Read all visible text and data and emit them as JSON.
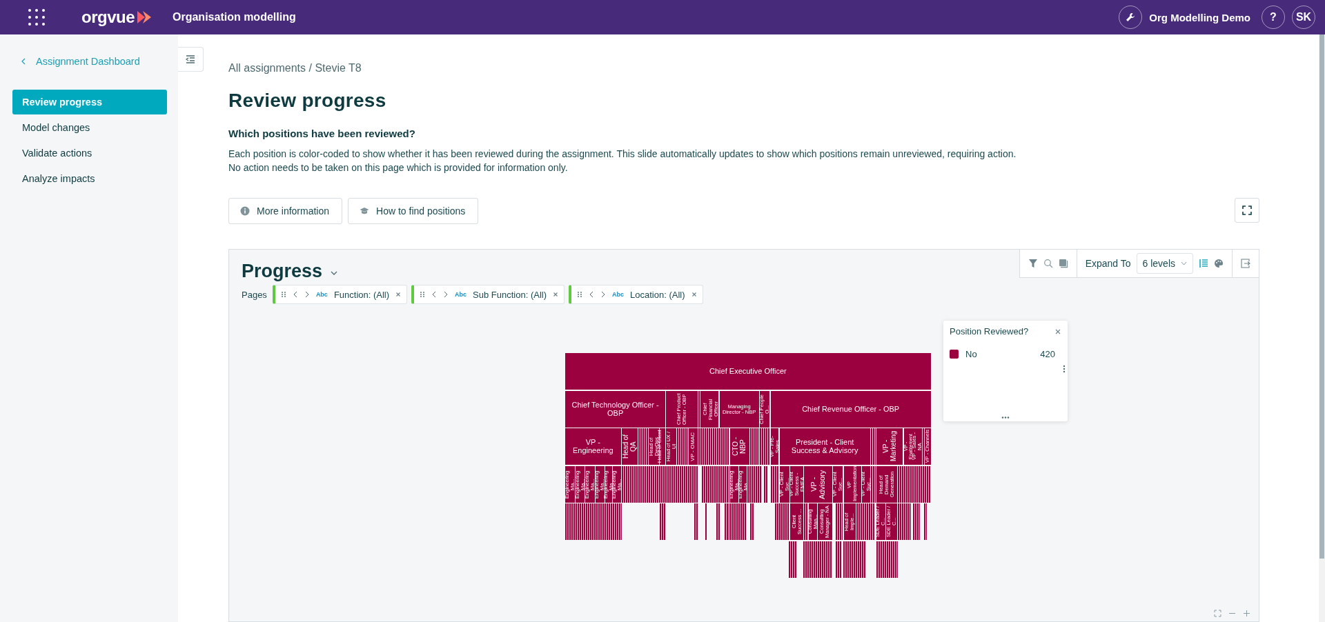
{
  "header": {
    "logo": "orgvue",
    "title": "Organisation modelling",
    "workspace": "Org Modelling Demo",
    "help": "?",
    "avatar": "SK"
  },
  "sidebar": {
    "back_link": "Assignment Dashboard",
    "items": [
      {
        "label": "Review progress",
        "selected": true
      },
      {
        "label": "Model changes",
        "selected": false
      },
      {
        "label": "Validate actions",
        "selected": false
      },
      {
        "label": "Analyze impacts",
        "selected": false
      }
    ]
  },
  "breadcrumb": "All assignments / Stevie T8",
  "title": "Review progress",
  "question": "Which positions have been reviewed?",
  "description": [
    "Each position is color-coded to show whether it has been reviewed during the assignment. This slide automatically updates to show which positions remain unreviewed, requiring action.",
    "No action needs to be taken on this page which is provided for information only."
  ],
  "buttons": [
    {
      "label": "More information",
      "kind": "info"
    },
    {
      "label": "How to find positions",
      "kind": "guide"
    }
  ],
  "panel": {
    "title": "Progress",
    "expand_label": "Expand To",
    "expand_value": "6 levels",
    "pages_label": "Pages",
    "filters": [
      {
        "type": "Abc",
        "label": "Function: (All)"
      },
      {
        "type": "Abc",
        "label": "Sub Function: (All)"
      },
      {
        "type": "Abc",
        "label": "Location: (All)"
      }
    ],
    "legend": {
      "title": "Position Reviewed?",
      "items": [
        {
          "label": "No",
          "count": "420",
          "color": "#9b003f"
        }
      ]
    },
    "org_chart": {
      "nodes": [
        "Chief Executive Officer",
        "Chief Technology Officer - OBP",
        "Chief Product Officer - OBP",
        "Chief Financial Officer",
        "Managing Director - NBP",
        "Chief People O...",
        "Chief Revenue Officer - OBP",
        "VP - Engineering",
        "Head of QA",
        "Head of DevOps",
        "Head of Client ...",
        "Head of UX / UI",
        "VP - OMAC",
        "CTO - NBP",
        "VP - Pre-Sales",
        "President - Client Success & Advisory",
        "VP - Marketing",
        "VP - Enablement",
        "VP - Sales - NA",
        "VP - Channels",
        "Engineering Ma...",
        "Engineering Ma...",
        "Engineering Ma...",
        "Engineering Ma...",
        "Engineering Ma...",
        "Engineering Ma...",
        "Engineering Ma...",
        "Engineering Ma...",
        "VP - Client Suc...",
        "VP - Client Success - EMEA",
        "VP - Advisory",
        "VP - Client Suc...",
        "VP Implementation",
        "VP - Client Suc...",
        "Head of Demand Generation",
        "Client Success ...",
        "Consulting Man...",
        "Consulting Manager - NA",
        "Head of Imple...",
        "SDE Leader / C...",
        "SDE Leader / C..."
      ]
    }
  }
}
